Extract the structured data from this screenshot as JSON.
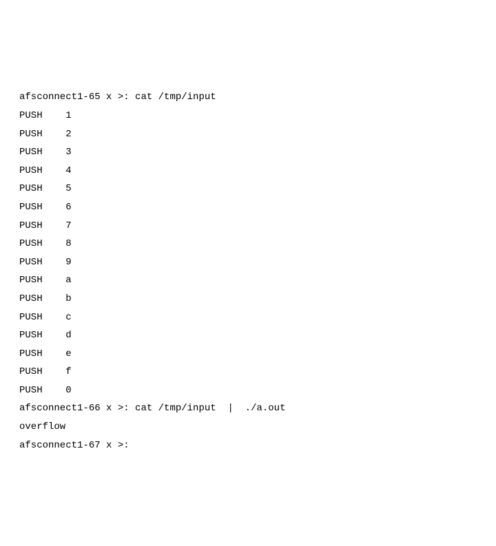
{
  "commands": [
    {
      "prompt": "afsconnect1-65 x >:",
      "command": " cat /tmp/input"
    },
    {
      "prompt": "afsconnect1-66 x >:",
      "command": " cat /tmp/input  |  ./a.out"
    },
    {
      "prompt": "afsconnect1-67 x >:",
      "command": ""
    }
  ],
  "output_rows": [
    {
      "op": "PUSH",
      "val": "1"
    },
    {
      "op": "PUSH",
      "val": "2"
    },
    {
      "op": "PUSH",
      "val": "3"
    },
    {
      "op": "PUSH",
      "val": "4"
    },
    {
      "op": "PUSH",
      "val": "5"
    },
    {
      "op": "PUSH",
      "val": "6"
    },
    {
      "op": "PUSH",
      "val": "7"
    },
    {
      "op": "PUSH",
      "val": "8"
    },
    {
      "op": "PUSH",
      "val": "9"
    },
    {
      "op": "PUSH",
      "val": "a"
    },
    {
      "op": "PUSH",
      "val": "b"
    },
    {
      "op": "PUSH",
      "val": "c"
    },
    {
      "op": "PUSH",
      "val": "d"
    },
    {
      "op": "PUSH",
      "val": "e"
    },
    {
      "op": "PUSH",
      "val": "f"
    },
    {
      "op": "PUSH",
      "val": "0"
    }
  ],
  "output2": "overflow"
}
